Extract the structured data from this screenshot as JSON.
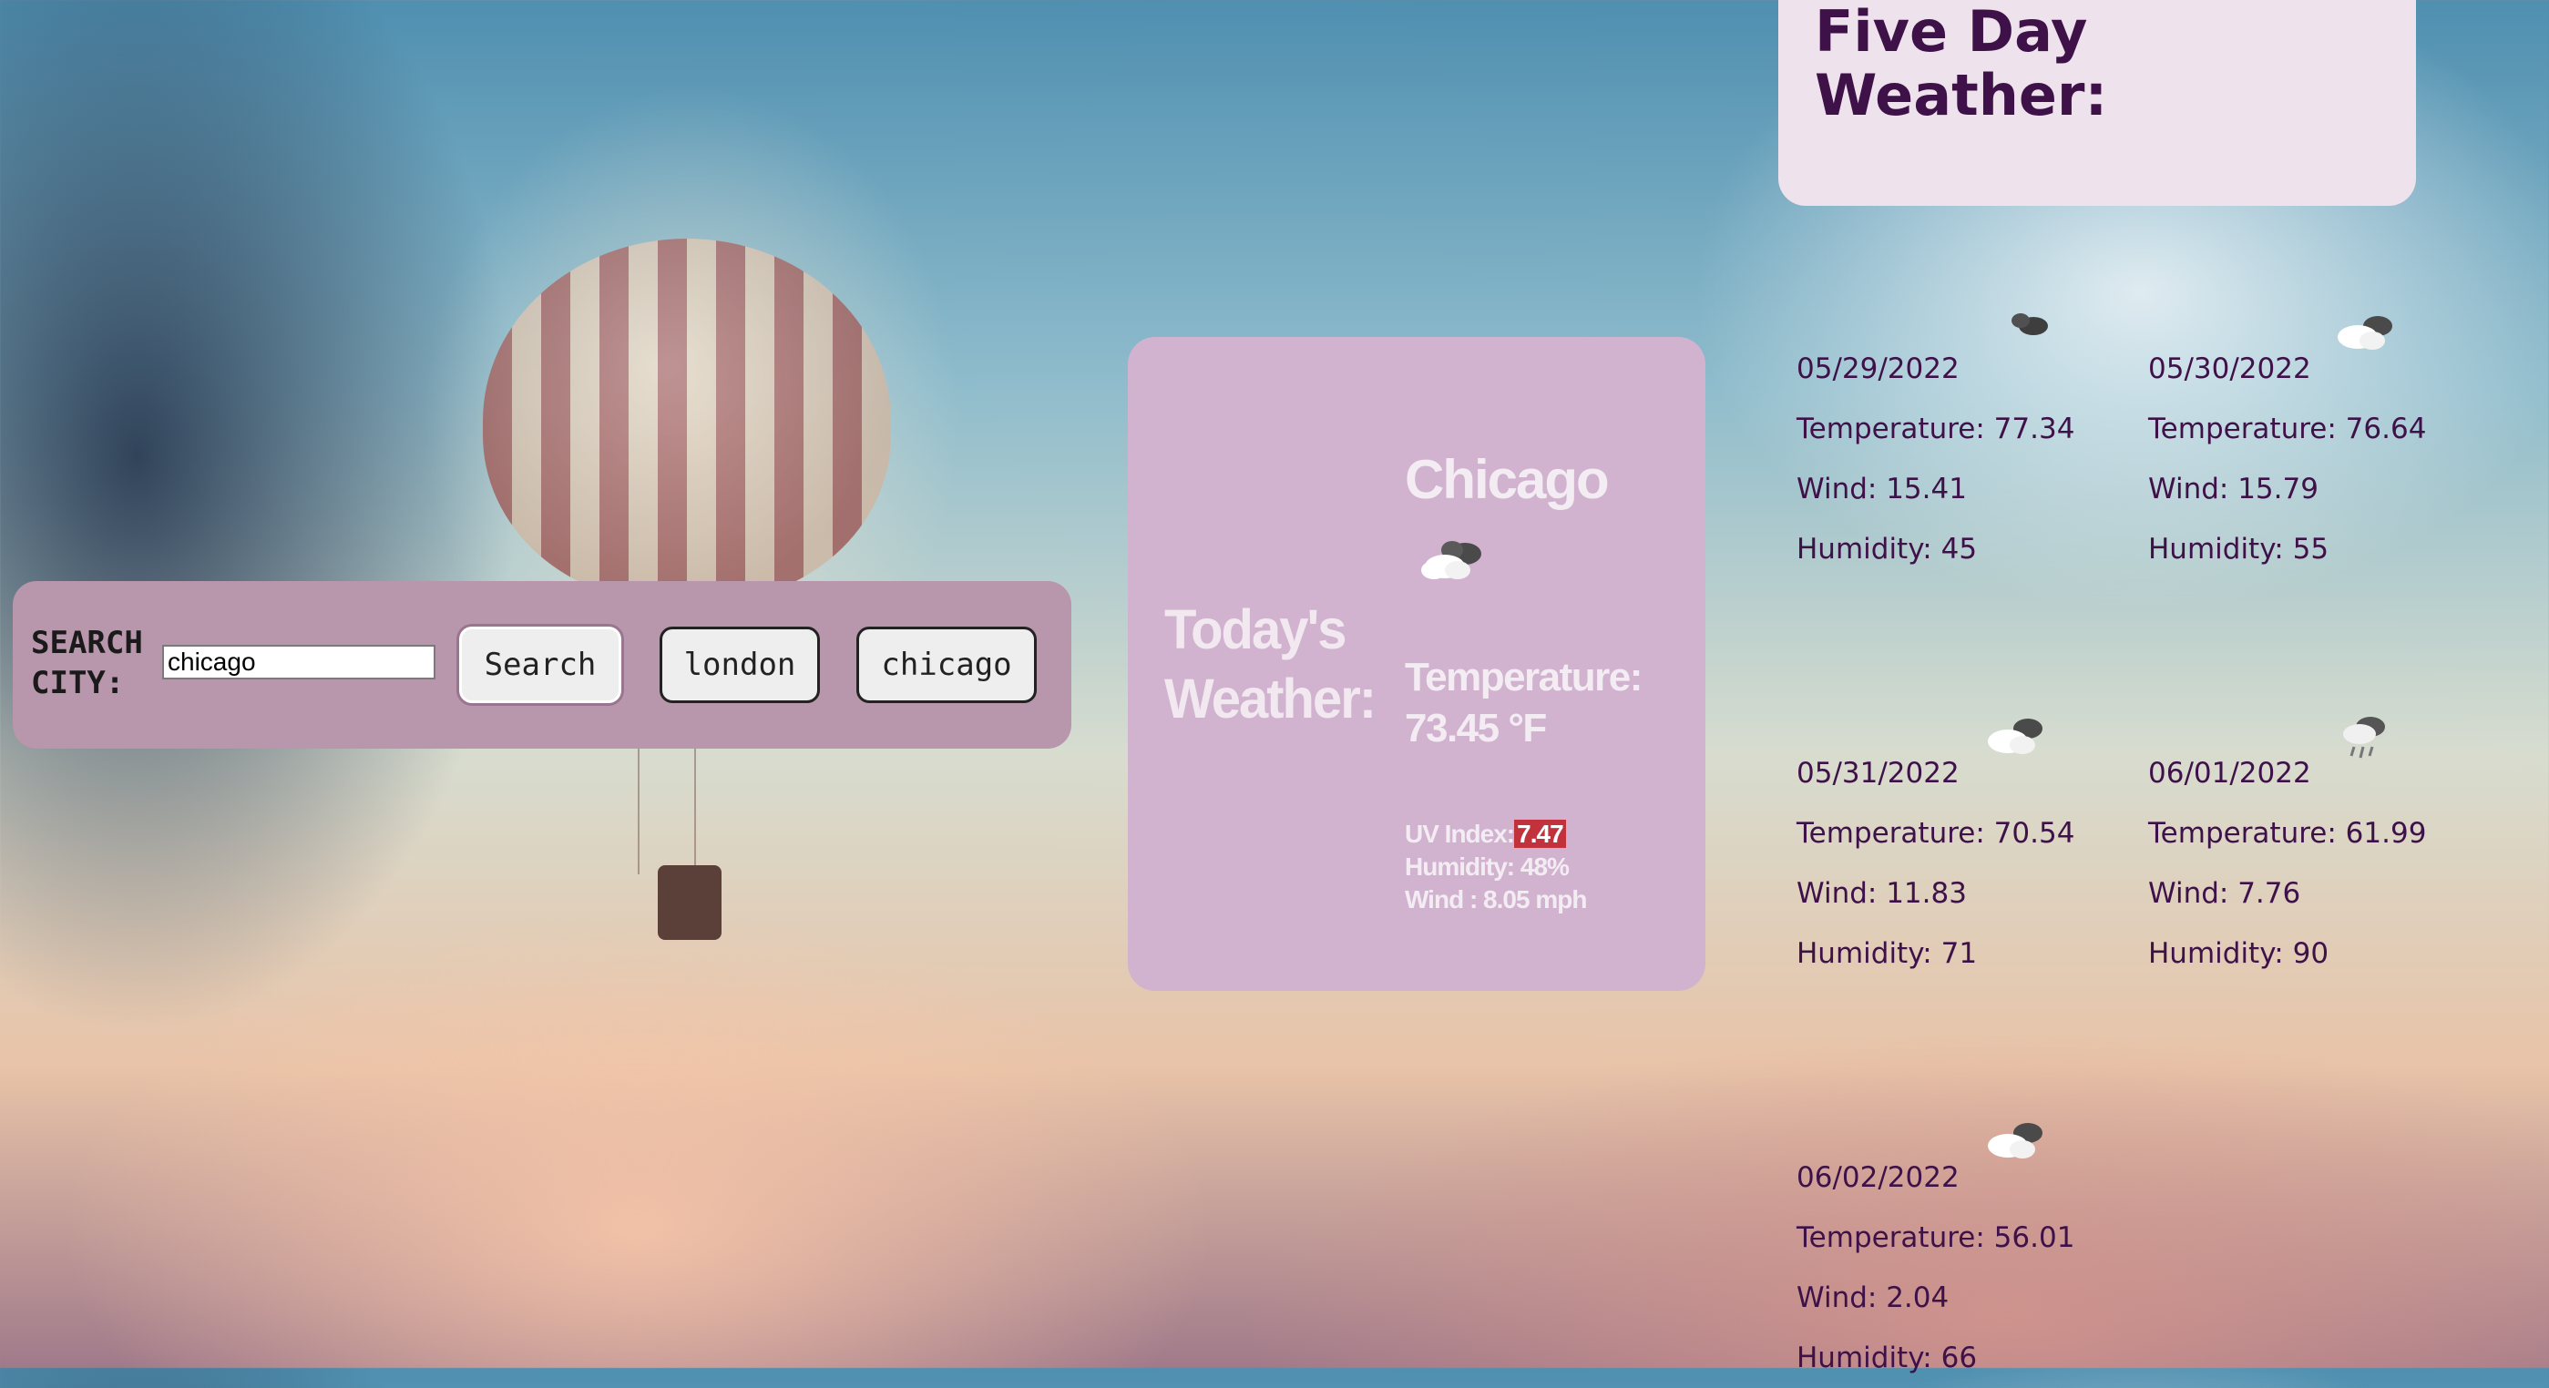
{
  "search": {
    "label": "SEARCH CITY:",
    "input_value": "chicago",
    "search_button": "Search",
    "history": [
      "london",
      "chicago"
    ]
  },
  "today": {
    "title": "Today's Weather:",
    "city": "Chicago",
    "icon": "cloud-icon",
    "temperature_label": "Temperature:",
    "temperature_value": "73.45 °F",
    "uv_label": "UV Index:",
    "uv_value": "7.47",
    "humidity": "Humidity: 48%",
    "wind": "Wind : 8.05 mph",
    "colors": {
      "card": "#d1b3d0",
      "text": "#f4ecf3",
      "uv_badge": "#c2323c"
    }
  },
  "five_day": {
    "title": "Five Day Weather:",
    "days": [
      {
        "date": "05/29/2022",
        "temperature": "Temperature: 77.34",
        "wind": "Wind: 15.41",
        "humidity": "Humidity: 45",
        "icon": "dark-cloud-icon"
      },
      {
        "date": "05/30/2022",
        "temperature": "Temperature: 76.64",
        "wind": "Wind: 15.79",
        "humidity": "Humidity: 55",
        "icon": "cloud-icon"
      },
      {
        "date": "05/31/2022",
        "temperature": "Temperature: 70.54",
        "wind": "Wind: 11.83",
        "humidity": "Humidity: 71",
        "icon": "cloud-icon"
      },
      {
        "date": "06/01/2022",
        "temperature": "Temperature: 61.99",
        "wind": "Wind: 7.76",
        "humidity": "Humidity: 90",
        "icon": "rain-cloud-icon"
      },
      {
        "date": "06/02/2022",
        "temperature": "Temperature: 56.01",
        "wind": "Wind: 2.04",
        "humidity": "Humidity: 66",
        "icon": "cloud-icon"
      }
    ],
    "colors": {
      "card": "#eee2ec",
      "text": "#3e1248"
    }
  }
}
